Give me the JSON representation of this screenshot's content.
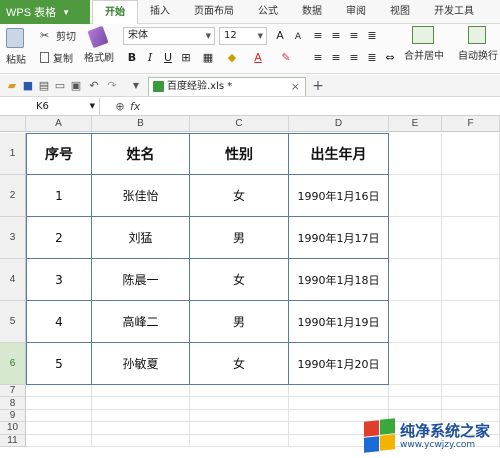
{
  "app": {
    "name": "WPS 表格"
  },
  "menu_tabs": [
    "开始",
    "插入",
    "页面布局",
    "公式",
    "数据",
    "审阅",
    "视图",
    "开发工具"
  ],
  "ribbon": {
    "paste_label": "粘贴",
    "cut_label": "剪切",
    "copy_label": "复制",
    "format_painter_label": "格式刷",
    "font_name": "宋体",
    "font_size": "12",
    "bold": "B",
    "italic": "I",
    "underline": "U",
    "font_color_glyph": "A",
    "merge_label": "合并居中",
    "wrap_label": "自动换行"
  },
  "document_tab": {
    "title": "百度经验.xls *"
  },
  "formula_bar": {
    "cell_ref": "K6",
    "fx": "fx",
    "value": ""
  },
  "columns": [
    "A",
    "B",
    "C",
    "D",
    "E",
    "F"
  ],
  "rows": [
    "1",
    "2",
    "3",
    "4",
    "5",
    "6",
    "7",
    "8",
    "9",
    "10",
    "11"
  ],
  "table": {
    "headers": [
      "序号",
      "姓名",
      "性别",
      "出生年月"
    ],
    "rows": [
      [
        "1",
        "张佳怡",
        "女",
        "1990年1月16日"
      ],
      [
        "2",
        "刘猛",
        "男",
        "1990年1月17日"
      ],
      [
        "3",
        "陈晨一",
        "女",
        "1990年1月18日"
      ],
      [
        "4",
        "高峰二",
        "男",
        "1990年1月19日"
      ],
      [
        "5",
        "孙敏夏",
        "女",
        "1990年1月20日"
      ]
    ]
  },
  "selected_row": "6",
  "watermark": {
    "title": "纯净系统之家",
    "url": "www.ycwjzy.com"
  },
  "colors": {
    "accent": "#4f9a3f",
    "table_border": "#5a7aa0"
  }
}
